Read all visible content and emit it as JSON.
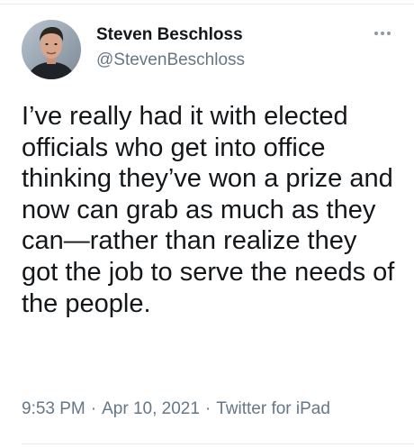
{
  "tweet": {
    "author": {
      "display_name": "Steven Beschloss",
      "handle": "@StevenBeschloss",
      "avatar_icon": "profile-photo"
    },
    "more_icon": "more-options-icon",
    "text": "I’ve really had it with elected officials who get into office thinking they’ve won a prize and now can grab as much as they can—rather than realize they got the job to serve the needs of the people.",
    "time": "9:53 PM",
    "separator": "·",
    "date": "Apr 10, 2021",
    "source": "Twitter for iPad"
  },
  "colors": {
    "primary_text": "#14171a",
    "secondary_text": "#657786",
    "divider": "#e6ecf0"
  }
}
